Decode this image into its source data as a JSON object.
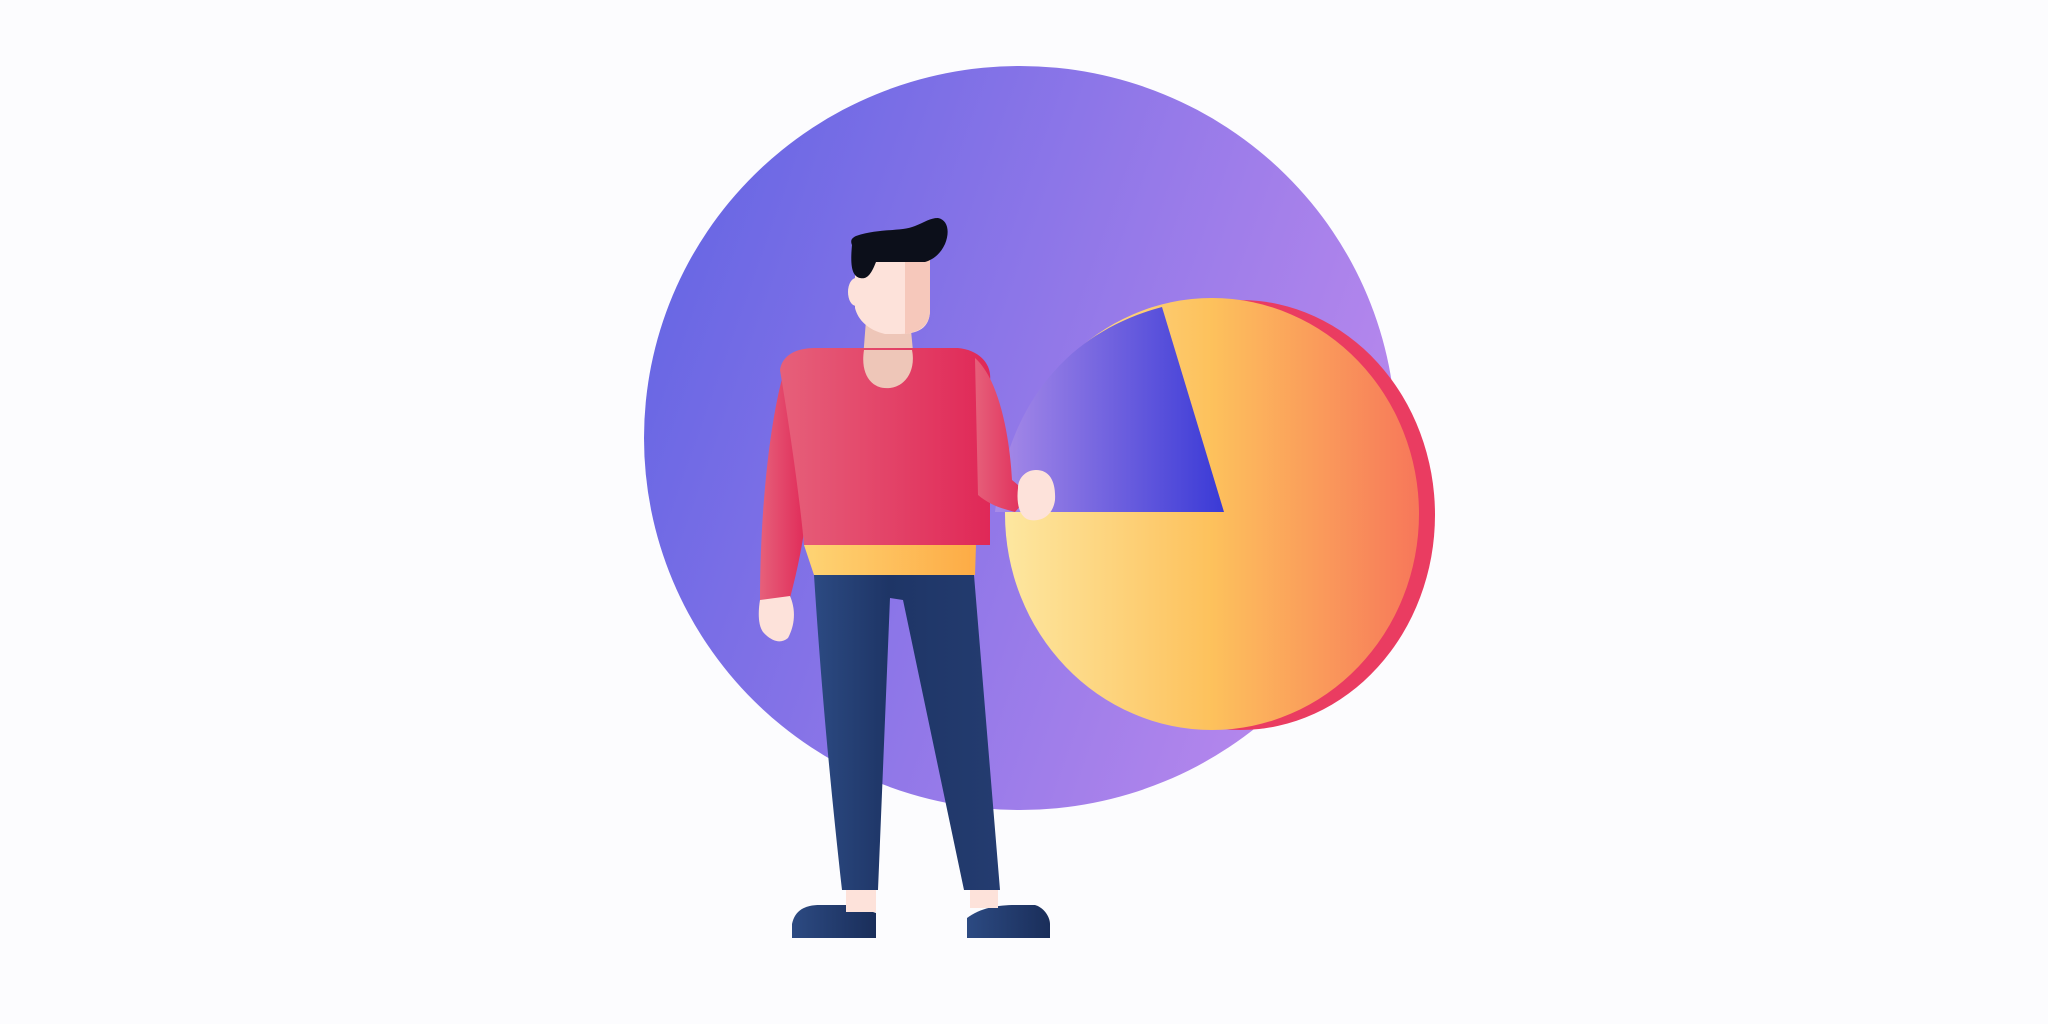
{
  "illustration": {
    "subject": "person-presenting-pie-chart",
    "icon": "pie-chart-icon"
  },
  "colors": {
    "background": "#fcfcfe",
    "circle_start": "#5f63e3",
    "circle_end": "#b386ec",
    "pie_yellow_light": "#fde7a0",
    "pie_yellow": "#fdc15c",
    "pie_orange": "#f7775a",
    "pie_shadow": "#ea3c61",
    "slice_light": "#a88be8",
    "slice_dark": "#3a3ad6",
    "sweater_light": "#e6607a",
    "sweater_dark": "#e02857",
    "belt_light": "#fed474",
    "belt_dark": "#fdab45",
    "pants": "#1e3566",
    "pants_light": "#2c4a82",
    "skin": "#fde2da",
    "skin_shadow": "#f6c8bb",
    "neck": "#eec6b8",
    "hair": "#0c0f1a"
  }
}
